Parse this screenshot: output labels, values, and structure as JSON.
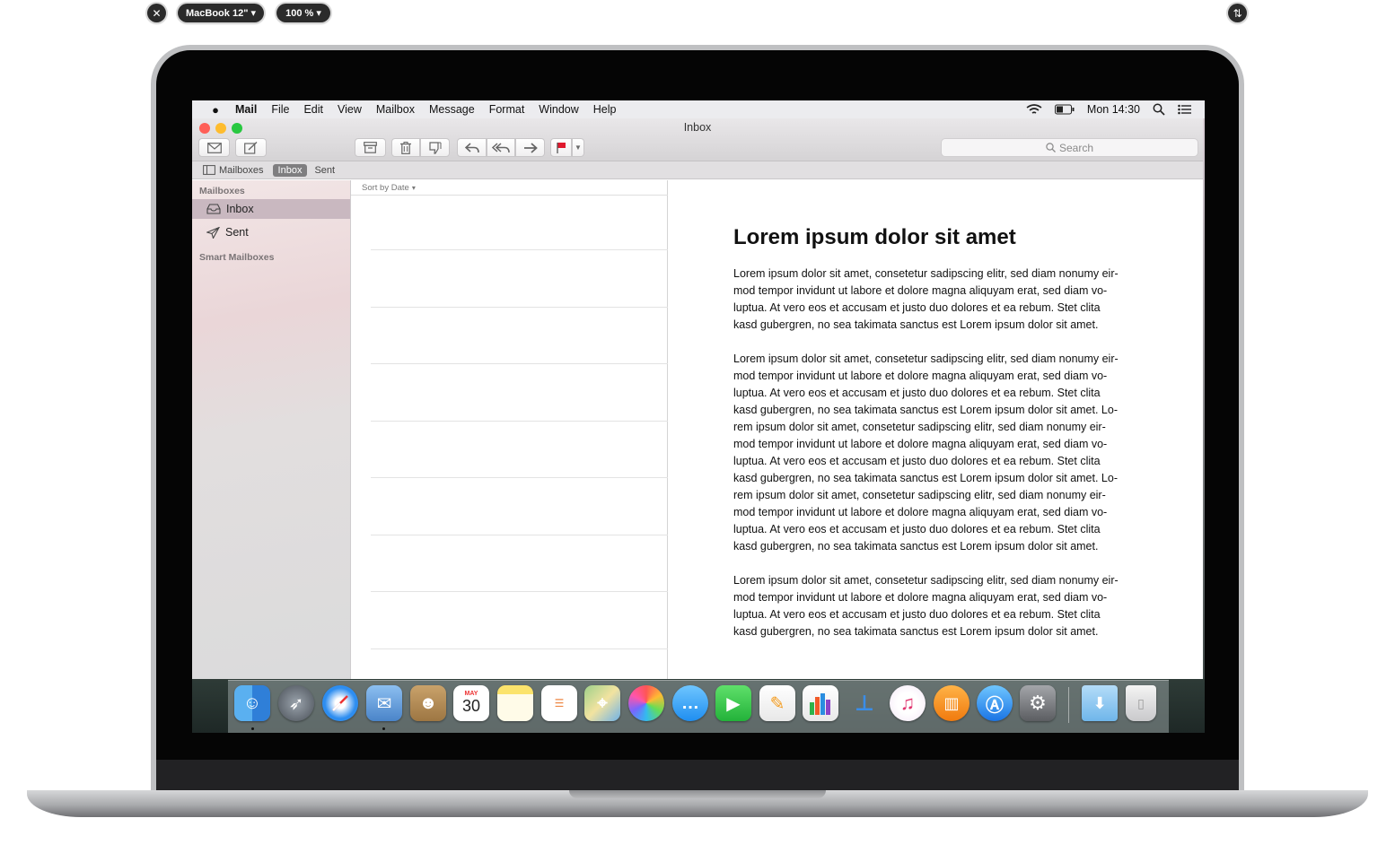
{
  "preview": {
    "device": "MacBook 12\" ▾",
    "zoom": "100 % ▾"
  },
  "menubar": {
    "app": "Mail",
    "items": [
      "File",
      "Edit",
      "View",
      "Mailbox",
      "Message",
      "Format",
      "Window",
      "Help"
    ],
    "clock": "Mon 14:30"
  },
  "window": {
    "title": "Inbox",
    "search_placeholder": "Search"
  },
  "favorites": {
    "mailboxes": "Mailboxes",
    "inbox": "Inbox",
    "sent": "Sent"
  },
  "sidebar": {
    "header": "Mailboxes",
    "items": [
      {
        "label": "Inbox",
        "icon": "inbox-tray-icon"
      },
      {
        "label": "Sent",
        "icon": "paper-plane-icon"
      }
    ],
    "smart_header": "Smart Mailboxes"
  },
  "message_list": {
    "sort_label": "Sort by Date"
  },
  "message": {
    "title": "Lorem ipsum dolor sit amet",
    "paragraphs": [
      "Lorem ipsum dolor sit amet, consetetur sadipscing elitr, sed diam nonumy eir-\nmod tempor invidunt ut labore et dolore magna aliquyam erat, sed diam vo-\nluptua. At vero eos et accusam et justo duo dolores et ea rebum. Stet clita\nkasd gubergren, no sea takimata sanctus est Lorem ipsum dolor sit amet.",
      "Lorem ipsum dolor sit amet, consetetur sadipscing elitr, sed diam nonumy eir-\nmod tempor invidunt ut labore et dolore magna aliquyam erat, sed diam vo-\nluptua. At vero eos et accusam et justo duo dolores et ea rebum. Stet clita\nkasd gubergren, no sea takimata sanctus est Lorem ipsum dolor sit amet. Lo-\nrem ipsum dolor sit amet, consetetur sadipscing elitr, sed diam nonumy eir-\nmod tempor invidunt ut labore et dolore magna aliquyam erat, sed diam vo-\nluptua. At vero eos et accusam et justo duo dolores et ea rebum. Stet clita\nkasd gubergren, no sea takimata sanctus est Lorem ipsum dolor sit amet. Lo-\nrem ipsum dolor sit amet, consetetur sadipscing elitr, sed diam nonumy eir-\nmod tempor invidunt ut labore et dolore magna aliquyam erat, sed diam vo-\nluptua. At vero eos et accusam et justo duo dolores et ea rebum. Stet clita\nkasd gubergren, no sea takimata sanctus est Lorem ipsum dolor sit amet.",
      "Lorem ipsum dolor sit amet, consetetur sadipscing elitr, sed diam nonumy eir-\nmod tempor invidunt ut labore et dolore magna aliquyam erat, sed diam vo-\nluptua. At vero eos et accusam et justo duo dolores et ea rebum. Stet clita\nkasd gubergren, no sea takimata sanctus est Lorem ipsum dolor sit amet."
    ]
  },
  "dock": {
    "calendar_month": "MAY",
    "calendar_day": "30",
    "apps": [
      "finder-icon",
      "launchpad-icon",
      "safari-icon",
      "mail-icon",
      "contacts-icon",
      "calendar-icon",
      "notes-icon",
      "reminders-icon",
      "maps-icon",
      "photos-icon",
      "messages-icon",
      "facetime-icon",
      "pages-icon",
      "numbers-icon",
      "keynote-icon",
      "itunes-icon",
      "ibooks-icon",
      "app-store-icon",
      "system-preferences-icon",
      "downloads-folder-icon",
      "trash-icon"
    ]
  },
  "colors": {
    "accent_red": "#ff5f57",
    "accent_yellow": "#febc2e",
    "accent_green": "#28c840",
    "flag_red": "#e0182d"
  }
}
